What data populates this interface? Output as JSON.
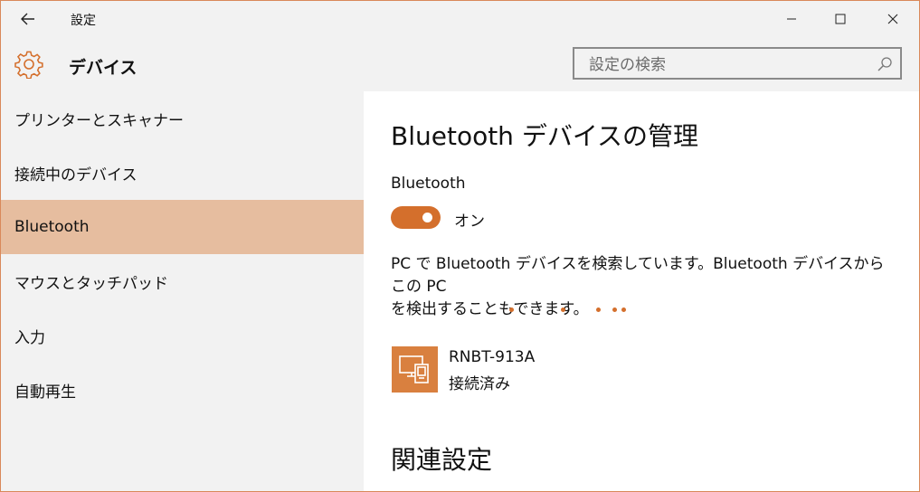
{
  "window": {
    "title": "設定"
  },
  "header": {
    "title": "デバイス",
    "search_placeholder": "設定の検索"
  },
  "sidebar": {
    "items": [
      {
        "label": "プリンターとスキャナー"
      },
      {
        "label": "接続中のデバイス"
      },
      {
        "label": "Bluetooth",
        "selected": true
      },
      {
        "label": "マウスとタッチパッド"
      },
      {
        "label": "入力"
      },
      {
        "label": "自動再生"
      }
    ]
  },
  "main": {
    "heading": "Bluetooth デバイスの管理",
    "bluetooth_label": "Bluetooth",
    "toggle_state": "オン",
    "toggle_on": true,
    "description_line1": "PC で Bluetooth デバイスを検索しています。Bluetooth デバイスからこの PC",
    "description_line2": "を検出することもできます。",
    "device": {
      "name": "RNBT-913A",
      "status": "接続済み",
      "icon": "device-pc-phone-icon"
    },
    "related_heading": "関連設定"
  },
  "colors": {
    "accent": "#d46f2c",
    "selected_nav": "#e6bd9f",
    "device_tile": "#d9803f"
  }
}
